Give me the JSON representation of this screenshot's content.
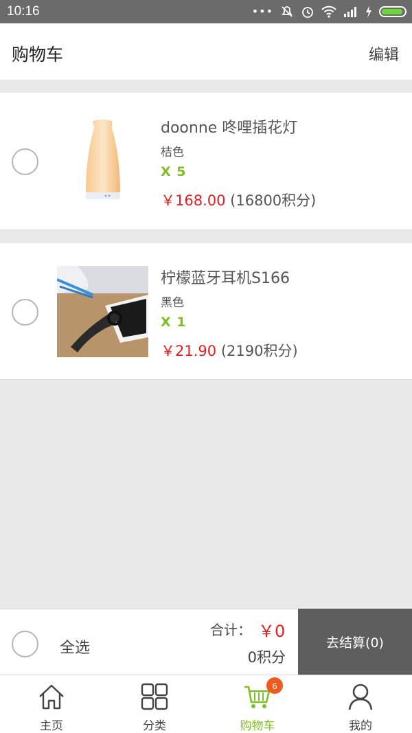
{
  "status_bar": {
    "time": "10:16"
  },
  "header": {
    "title": "购物车",
    "edit_label": "编辑"
  },
  "items": [
    {
      "name": "doonne 咚哩插花灯",
      "color": "桔色",
      "quantity": "X  5",
      "price": "￥168.00",
      "points": "(16800积分)"
    },
    {
      "name": "柠檬蓝牙耳机S166",
      "color": "黑色",
      "quantity": "X  1",
      "price": "￥21.90",
      "points": "(2190积分)"
    }
  ],
  "footer": {
    "select_all_label": "全选",
    "total_label": "合计：",
    "total_value": "￥0",
    "total_points": "0积分",
    "checkout_label": "去结算(0)"
  },
  "tabbar": {
    "tabs": [
      {
        "label": "主页",
        "icon": "home-icon"
      },
      {
        "label": "分类",
        "icon": "grid-icon"
      },
      {
        "label": "购物车",
        "icon": "cart-icon"
      },
      {
        "label": "我的",
        "icon": "user-icon"
      }
    ],
    "cart_badge": "6",
    "active_color": "#7fbe26"
  },
  "colors": {
    "price": "#e02020",
    "quantity": "#7fbe26",
    "checkout_bg": "#5e5e5e"
  }
}
